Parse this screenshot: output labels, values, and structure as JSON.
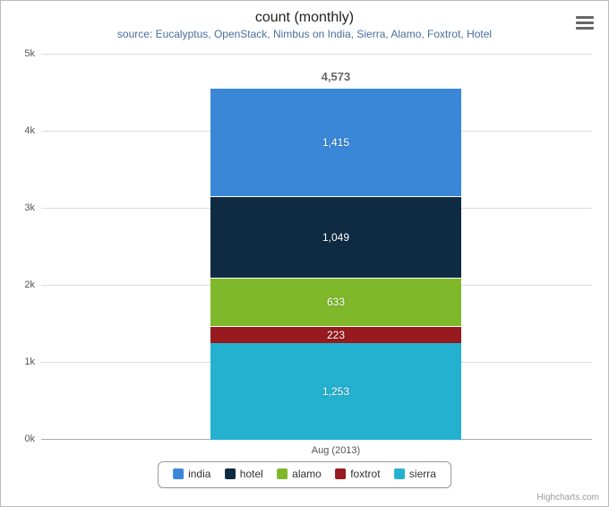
{
  "title": "count (monthly)",
  "subtitle": "source: Eucalyptus, OpenStack, Nimbus on India, Sierra, Alamo, Foxtrot, Hotel",
  "credits": "Highcharts.com",
  "x_category_label": "Aug (2013)",
  "stack_total_label": "4,573",
  "y_ticks": [
    "0k",
    "1k",
    "2k",
    "3k",
    "4k",
    "5k"
  ],
  "legend": {
    "india": "india",
    "hotel": "hotel",
    "alamo": "alamo",
    "foxtrot": "foxtrot",
    "sierra": "sierra"
  },
  "segments": {
    "india": {
      "label": "1,415",
      "color": "#3a87d8"
    },
    "hotel": {
      "label": "1,049",
      "color": "#0f2b44"
    },
    "alamo": {
      "label": "633",
      "color": "#7fb92b"
    },
    "foxtrot": {
      "label": "223",
      "color": "#961a1e"
    },
    "sierra": {
      "label": "1,253",
      "color": "#24b1cf"
    }
  },
  "chart_data": {
    "type": "bar",
    "stacked": true,
    "categories": [
      "Aug (2013)"
    ],
    "series": [
      {
        "name": "india",
        "values": [
          1415
        ]
      },
      {
        "name": "hotel",
        "values": [
          1049
        ]
      },
      {
        "name": "alamo",
        "values": [
          633
        ]
      },
      {
        "name": "foxtrot",
        "values": [
          223
        ]
      },
      {
        "name": "sierra",
        "values": [
          1253
        ]
      }
    ],
    "stack_totals": [
      4573
    ],
    "title": "count (monthly)",
    "subtitle": "source: Eucalyptus, OpenStack, Nimbus on India, Sierra, Alamo, Foxtrot, Hotel",
    "ylabel": "",
    "xlabel": "",
    "ylim": [
      0,
      5000
    ],
    "y_ticks": [
      0,
      1000,
      2000,
      3000,
      4000,
      5000
    ]
  }
}
